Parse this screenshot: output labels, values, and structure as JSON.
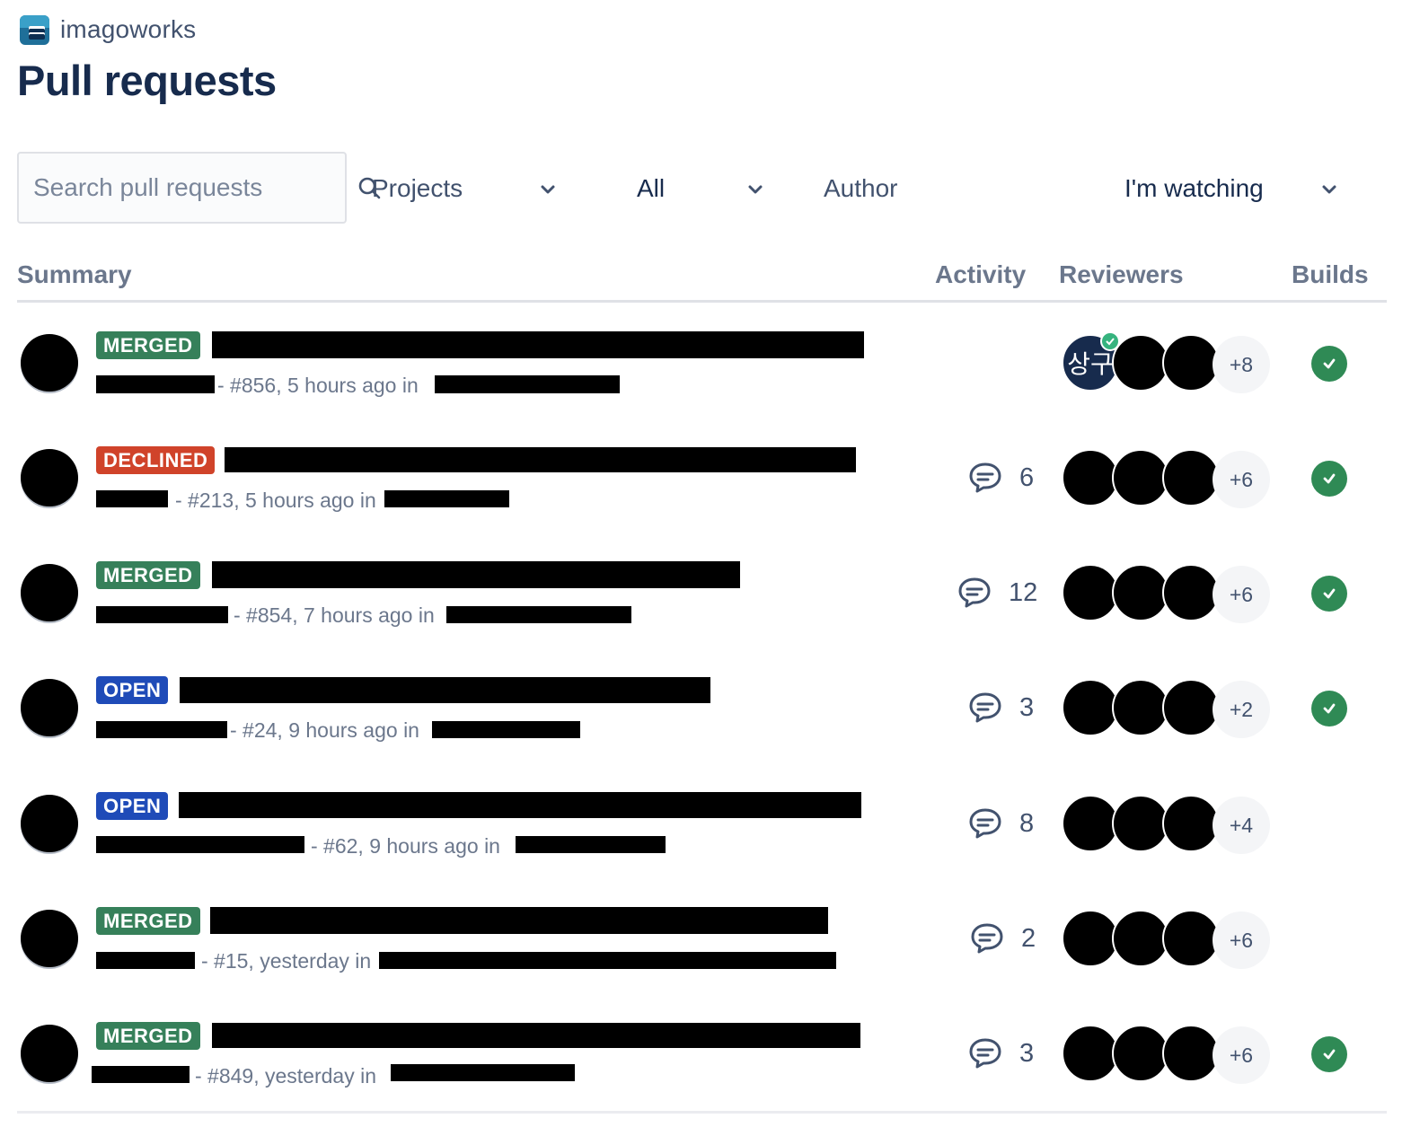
{
  "workspace": {
    "name": "imagoworks"
  },
  "page": {
    "title": "Pull requests"
  },
  "search": {
    "placeholder": "Search pull requests"
  },
  "filters": {
    "projects": "Projects",
    "state": "All",
    "author": "Author",
    "watching": "I'm watching"
  },
  "columns": {
    "summary": "Summary",
    "activity": "Activity",
    "reviewers": "Reviewers",
    "builds": "Builds"
  },
  "colors": {
    "merged": "#36805a",
    "declined": "#d0432a",
    "open": "#1f4bb8",
    "build_success": "#2f8a55",
    "approved": "#36b37e"
  },
  "pull_requests": [
    {
      "status": "MERGED",
      "meta": "- #856, 5 hours ago in",
      "comments": "",
      "reviewers_more": "+8",
      "first_reviewer_initials": "상구",
      "build_passed": true
    },
    {
      "status": "DECLINED",
      "meta": "- #213, 5 hours ago in",
      "comments": "6",
      "reviewers_more": "+6",
      "build_passed": true
    },
    {
      "status": "MERGED",
      "meta": "- #854, 7 hours ago in",
      "comments": "12",
      "reviewers_more": "+6",
      "build_passed": true
    },
    {
      "status": "OPEN",
      "meta": "- #24, 9 hours ago in",
      "comments": "3",
      "reviewers_more": "+2",
      "build_passed": true
    },
    {
      "status": "OPEN",
      "meta": "- #62, 9 hours ago in",
      "comments": "8",
      "reviewers_more": "+4",
      "build_passed": false
    },
    {
      "status": "MERGED",
      "meta": "- #15, yesterday in",
      "comments": "2",
      "reviewers_more": "+6",
      "build_passed": false
    },
    {
      "status": "MERGED",
      "meta": "- #849, yesterday in",
      "comments": "3",
      "reviewers_more": "+6",
      "build_passed": true
    }
  ]
}
